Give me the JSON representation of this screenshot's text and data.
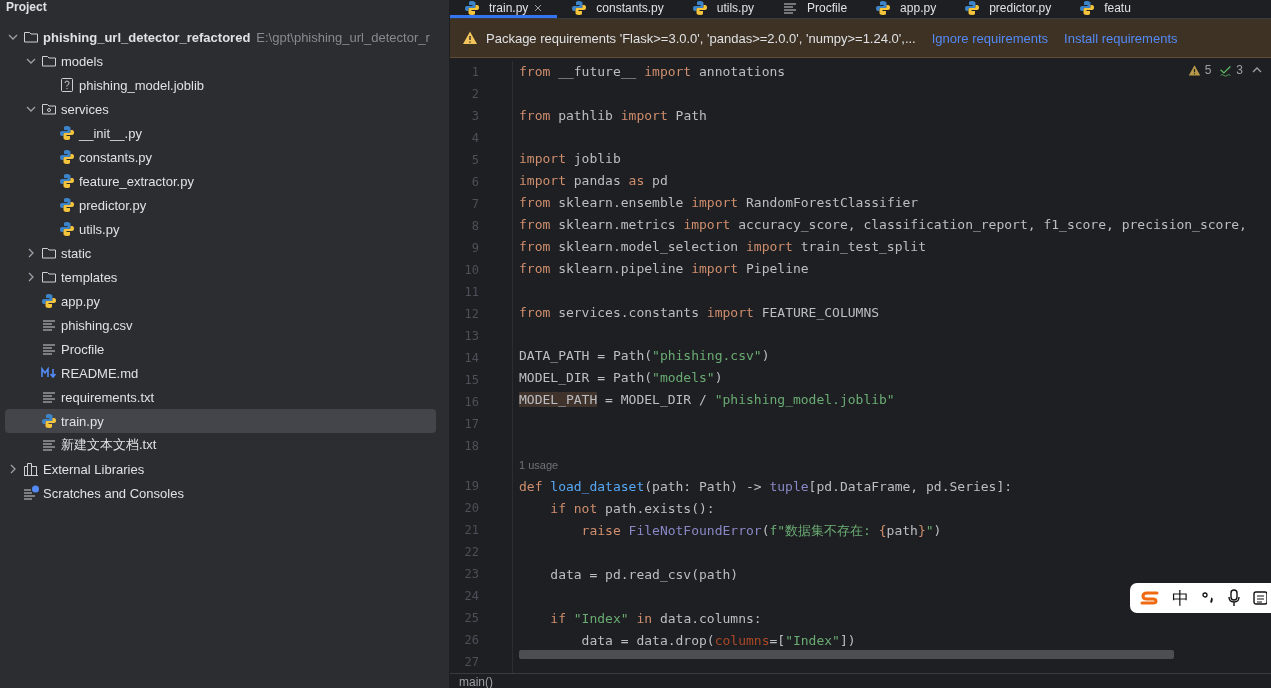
{
  "project_panel": {
    "title": "Project",
    "tree": [
      {
        "label": "phishing_url_detector_refactored",
        "path": "E:\\gpt\\phishing_url_detector_r",
        "kind": "folder",
        "expanded": true,
        "selected": false,
        "children": [
          {
            "label": "models",
            "kind": "folder",
            "expanded": true,
            "selected": false,
            "children": [
              {
                "label": "phishing_model.joblib",
                "kind": "unknown",
                "selected": false
              }
            ]
          },
          {
            "label": "services",
            "kind": "package",
            "expanded": true,
            "selected": false,
            "children": [
              {
                "label": "__init__.py",
                "kind": "python",
                "selected": false
              },
              {
                "label": "constants.py",
                "kind": "python",
                "selected": false
              },
              {
                "label": "feature_extractor.py",
                "kind": "python",
                "selected": false
              },
              {
                "label": "predictor.py",
                "kind": "python",
                "selected": false
              },
              {
                "label": "utils.py",
                "kind": "python",
                "selected": false
              }
            ]
          },
          {
            "label": "static",
            "kind": "folder",
            "expanded": false,
            "selected": false
          },
          {
            "label": "templates",
            "kind": "folder",
            "expanded": false,
            "selected": false
          },
          {
            "label": "app.py",
            "kind": "python",
            "selected": false
          },
          {
            "label": "phishing.csv",
            "kind": "text",
            "selected": false
          },
          {
            "label": "Procfile",
            "kind": "text",
            "selected": false
          },
          {
            "label": "README.md",
            "kind": "markdown",
            "selected": false
          },
          {
            "label": "requirements.txt",
            "kind": "text",
            "selected": false
          },
          {
            "label": "train.py",
            "kind": "python",
            "selected": true
          },
          {
            "label": "新建文本文档.txt",
            "kind": "text",
            "selected": false
          }
        ]
      },
      {
        "label": "External Libraries",
        "kind": "libraries",
        "expanded": false,
        "selected": false
      },
      {
        "label": "Scratches and Consoles",
        "kind": "scratches",
        "selected": false
      }
    ]
  },
  "tabs": [
    {
      "label": "train.py",
      "kind": "python",
      "selected": true,
      "closable": true
    },
    {
      "label": "constants.py",
      "kind": "python",
      "selected": false,
      "closable": false
    },
    {
      "label": "utils.py",
      "kind": "python",
      "selected": false,
      "closable": false
    },
    {
      "label": "Procfile",
      "kind": "text",
      "selected": false,
      "closable": false
    },
    {
      "label": "app.py",
      "kind": "python",
      "selected": false,
      "closable": false
    },
    {
      "label": "predictor.py",
      "kind": "python",
      "selected": false,
      "closable": false
    },
    {
      "label": "featu",
      "kind": "python",
      "selected": false,
      "closable": false
    }
  ],
  "banner": {
    "message": "Package requirements 'Flask>=3.0.0', 'pandas>=2.0.0', 'numpy>=1.24.0',...",
    "actions": [
      "Ignore requirements",
      "Install requirements"
    ]
  },
  "inspections": {
    "warnings": "5",
    "typos": "3"
  },
  "code": [
    {
      "kind": "code",
      "number": "1",
      "tokens": [
        {
          "kind": "kw",
          "text": "from"
        },
        {
          "kind": "p",
          "text": " __future__ "
        },
        {
          "kind": "kw",
          "text": "import"
        },
        {
          "kind": "p",
          "text": " annotations"
        }
      ]
    },
    {
      "kind": "code",
      "number": "2"
    },
    {
      "kind": "code",
      "number": "3",
      "tokens": [
        {
          "kind": "kw",
          "text": "from"
        },
        {
          "kind": "p",
          "text": " pathlib "
        },
        {
          "kind": "kw",
          "text": "import"
        },
        {
          "kind": "p",
          "text": " Path"
        }
      ]
    },
    {
      "kind": "code",
      "number": "4"
    },
    {
      "kind": "code",
      "number": "5",
      "tokens": [
        {
          "kind": "kw",
          "text": "import"
        },
        {
          "kind": "p",
          "text": " joblib"
        }
      ]
    },
    {
      "kind": "code",
      "number": "6",
      "tokens": [
        {
          "kind": "kw",
          "text": "import"
        },
        {
          "kind": "p",
          "text": " pandas "
        },
        {
          "kind": "kw",
          "text": "as"
        },
        {
          "kind": "p",
          "text": " pd"
        }
      ]
    },
    {
      "kind": "code",
      "number": "7",
      "tokens": [
        {
          "kind": "kw",
          "text": "from"
        },
        {
          "kind": "p",
          "text": " sklearn.ensemble "
        },
        {
          "kind": "kw",
          "text": "import"
        },
        {
          "kind": "p",
          "text": " RandomForestClassifier"
        }
      ]
    },
    {
      "kind": "code",
      "number": "8",
      "tokens": [
        {
          "kind": "kw",
          "text": "from"
        },
        {
          "kind": "p",
          "text": " sklearn.metrics "
        },
        {
          "kind": "kw",
          "text": "import"
        },
        {
          "kind": "p",
          "text": " accuracy_score, classification_report, f1_score, precision_score,"
        }
      ]
    },
    {
      "kind": "code",
      "number": "9",
      "tokens": [
        {
          "kind": "kw",
          "text": "from"
        },
        {
          "kind": "p",
          "text": " sklearn.model_selection "
        },
        {
          "kind": "kw",
          "text": "import"
        },
        {
          "kind": "p",
          "text": " train_test_split"
        }
      ]
    },
    {
      "kind": "code",
      "number": "10",
      "tokens": [
        {
          "kind": "kw",
          "text": "from"
        },
        {
          "kind": "p",
          "text": " sklearn.pipeline "
        },
        {
          "kind": "kw",
          "text": "import"
        },
        {
          "kind": "p",
          "text": " Pipeline"
        }
      ]
    },
    {
      "kind": "code",
      "number": "11"
    },
    {
      "kind": "code",
      "number": "12",
      "tokens": [
        {
          "kind": "kw",
          "text": "from"
        },
        {
          "kind": "p",
          "text": " services.constants "
        },
        {
          "kind": "kw",
          "text": "import"
        },
        {
          "kind": "p",
          "text": " FEATURE_COLUMNS"
        }
      ]
    },
    {
      "kind": "code",
      "number": "13"
    },
    {
      "kind": "code",
      "number": "14",
      "tokens": [
        {
          "kind": "p",
          "text": "DATA_PATH = Path("
        },
        {
          "kind": "str",
          "text": "\"phishing.csv\""
        },
        {
          "kind": "p",
          "text": ")"
        }
      ]
    },
    {
      "kind": "code",
      "number": "15",
      "tokens": [
        {
          "kind": "p",
          "text": "MODEL_DIR = Path("
        },
        {
          "kind": "str",
          "text": "\"models\""
        },
        {
          "kind": "p",
          "text": ")"
        }
      ]
    },
    {
      "kind": "code",
      "number": "16",
      "tokens": [
        {
          "kind": "hl",
          "text": "MODEL_PATH"
        },
        {
          "kind": "p",
          "text": " = MODEL_DIR / "
        },
        {
          "kind": "str",
          "text": "\"phishing_model.joblib\""
        }
      ]
    },
    {
      "kind": "code",
      "number": "17"
    },
    {
      "kind": "code",
      "number": "18"
    },
    {
      "kind": "hint",
      "text": "1 usage"
    },
    {
      "kind": "code",
      "number": "19",
      "tokens": [
        {
          "kind": "kw",
          "text": "def "
        },
        {
          "kind": "fn",
          "text": "load_dataset"
        },
        {
          "kind": "p",
          "text": "(path: Path) -> "
        },
        {
          "kind": "bi",
          "text": "tuple"
        },
        {
          "kind": "p",
          "text": "[pd.DataFrame, pd.Series]:"
        }
      ]
    },
    {
      "kind": "code",
      "number": "20",
      "tokens": [
        {
          "kind": "kw",
          "text": "    if not"
        },
        {
          "kind": "p",
          "text": " path.exists():"
        }
      ]
    },
    {
      "kind": "code",
      "number": "21",
      "tokens": [
        {
          "kind": "kw",
          "text": "        raise"
        },
        {
          "kind": "bi",
          "text": " FileNotFoundError"
        },
        {
          "kind": "p",
          "text": "("
        },
        {
          "kind": "str",
          "text": "f\"数据集不存在: "
        },
        {
          "kind": "kw",
          "text": "{"
        },
        {
          "kind": "p",
          "text": "path"
        },
        {
          "kind": "kw",
          "text": "}"
        },
        {
          "kind": "str",
          "text": "\""
        },
        {
          "kind": "p",
          "text": ")"
        }
      ]
    },
    {
      "kind": "code",
      "number": "22"
    },
    {
      "kind": "code",
      "number": "23",
      "tokens": [
        {
          "kind": "p",
          "text": "    data = pd.read_csv(path)"
        }
      ]
    },
    {
      "kind": "code",
      "number": "24"
    },
    {
      "kind": "code",
      "number": "25",
      "tokens": [
        {
          "kind": "kw",
          "text": "    if"
        },
        {
          "kind": "str",
          "text": " \"Index\""
        },
        {
          "kind": "kw",
          "text": " in"
        },
        {
          "kind": "p",
          "text": " data.columns:"
        }
      ]
    },
    {
      "kind": "code",
      "number": "26",
      "tokens": [
        {
          "kind": "p",
          "text": "        data = data.drop("
        },
        {
          "kind": "arg",
          "text": "columns"
        },
        {
          "kind": "p",
          "text": "=["
        },
        {
          "kind": "str",
          "text": "\"Index\""
        },
        {
          "kind": "p",
          "text": "])"
        }
      ]
    },
    {
      "kind": "code",
      "number": "27"
    }
  ],
  "breadcrumb": "main()",
  "ime_toolbar": {
    "mode": "中"
  }
}
